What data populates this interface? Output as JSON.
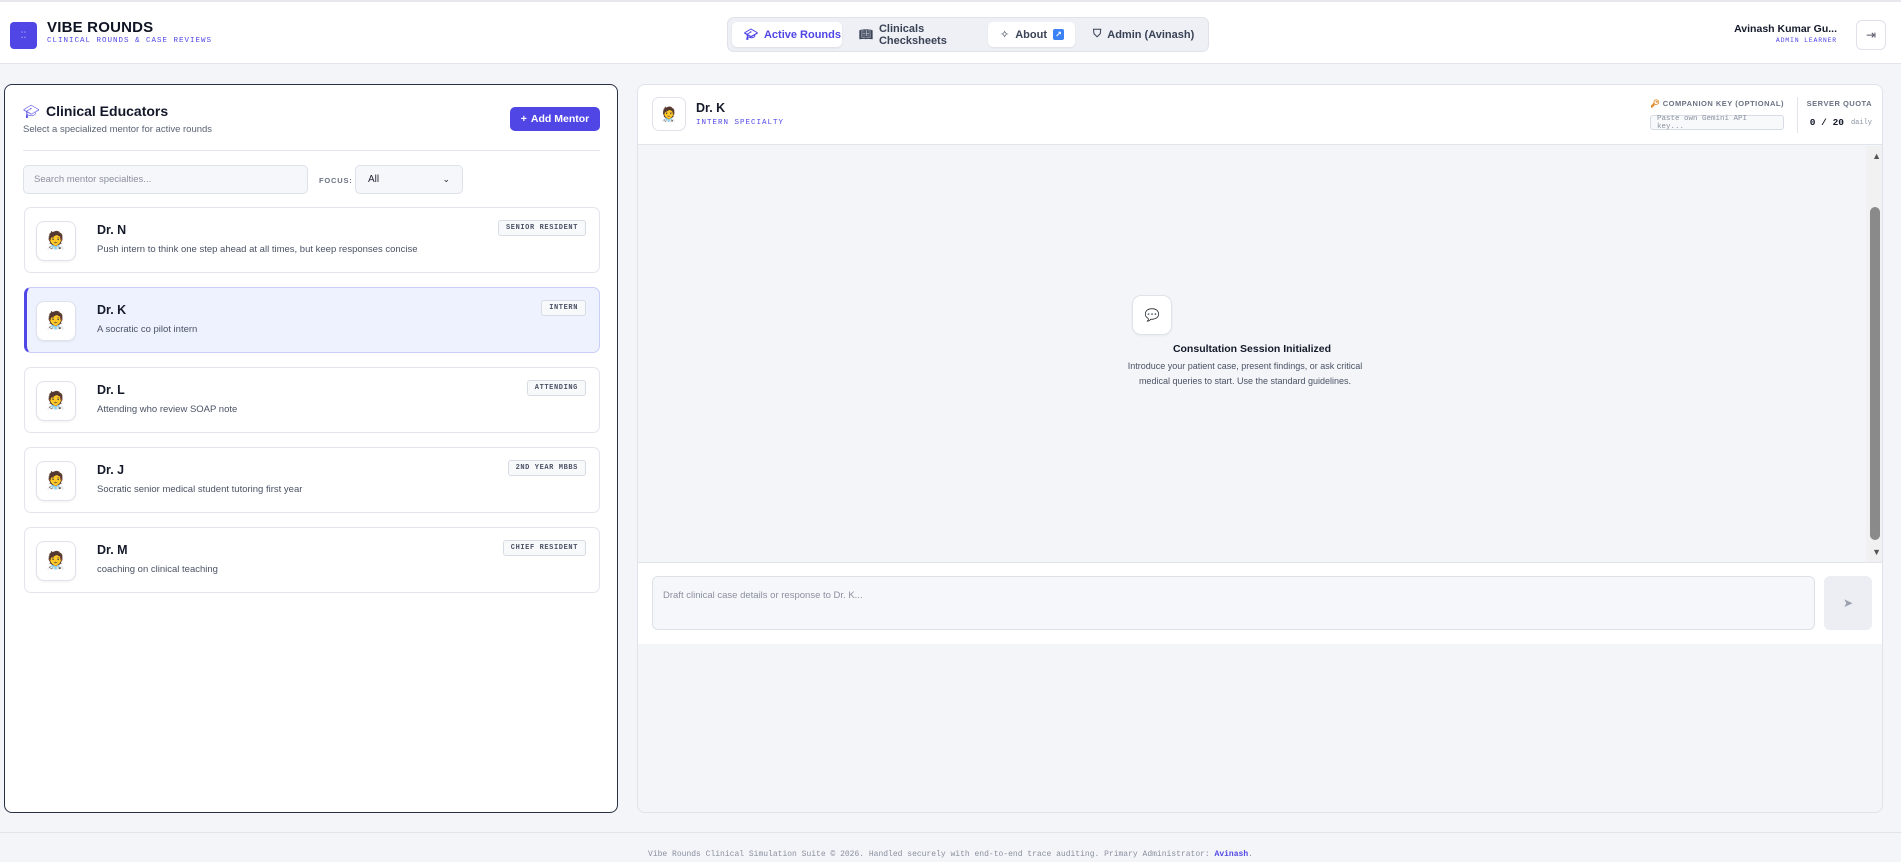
{
  "brand": {
    "title": "VIBE ROUNDS",
    "subtitle": "CLINICAL ROUNDS & CASE REVIEWS"
  },
  "nav": {
    "items": [
      {
        "label": "Active Rounds",
        "icon": "graduation-cap-icon",
        "active": true
      },
      {
        "label": "Clinicals Checksheets",
        "icon": "book-open-icon"
      },
      {
        "label": "About",
        "icon": "sparkles-icon",
        "badge": "↗"
      },
      {
        "label": "Admin (Avinash)",
        "icon": "shield-icon"
      }
    ]
  },
  "user": {
    "name": "Avinash Kumar Gu...",
    "role": "ADMIN LEARNER"
  },
  "mentors_panel": {
    "title": "Clinical Educators",
    "subtitle": "Select a specialized mentor for active rounds",
    "add_button": "Add Mentor",
    "search_placeholder": "Search mentor specialties...",
    "focus_label": "FOCUS:",
    "focus_value": "All",
    "mentors": [
      {
        "name": "Dr. N",
        "desc": "Push intern to think one step ahead at all times, but keep responses concise",
        "badge": "SENIOR RESIDENT"
      },
      {
        "name": "Dr. K",
        "desc": "A socratic co pilot intern",
        "badge": "INTERN",
        "selected": true
      },
      {
        "name": "Dr. L",
        "desc": "Attending who review SOAP note",
        "badge": "ATTENDING"
      },
      {
        "name": "Dr. J",
        "desc": "Socratic senior medical student tutoring first year",
        "badge": "2ND YEAR MBBS"
      },
      {
        "name": "Dr. M",
        "desc": "coaching on clinical teaching",
        "badge": "CHIEF RESIDENT"
      }
    ]
  },
  "consult": {
    "mentor_name": "Dr. K",
    "specialty": "INTERN SPECIALTY",
    "companion_key_label": "COMPANION KEY (OPTIONAL)",
    "companion_key_placeholder": "Paste own Gemini API key...",
    "quota_label": "SERVER QUOTA",
    "quota_value": "0 / 20",
    "quota_unit": "daily",
    "empty_title": "Consultation Session Initialized",
    "empty_sub": "Introduce your patient case, present findings, or ask critical medical queries to start. Use the standard guidelines.",
    "composer_placeholder": "Draft clinical case details or response to Dr. K..."
  },
  "footer": {
    "text": "Vibe Rounds Clinical Simulation Suite © 2026. Handled securely with end-to-end trace auditing. Primary Administrator: ",
    "admin_link": "Avinash",
    "end": "."
  },
  "colors": {
    "accent": "#4f46e5",
    "selected_bg": "#eef2fe"
  }
}
